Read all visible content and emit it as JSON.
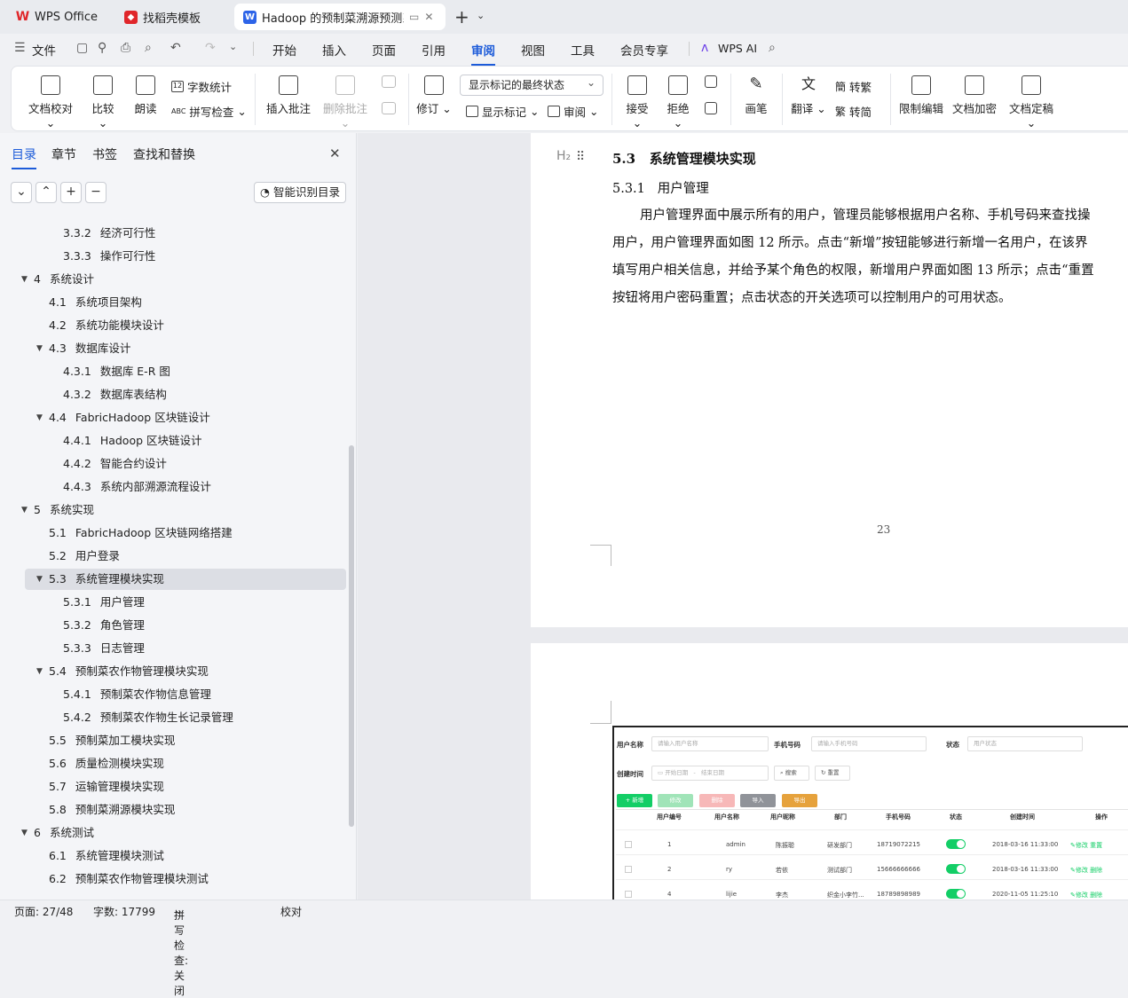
{
  "tabs": [
    {
      "label": "WPS Office"
    },
    {
      "label": "找稻壳模板"
    },
    {
      "label": "Hadoop 的预制菜溯源预测系"
    }
  ],
  "menu": {
    "file": "文件",
    "items": [
      "开始",
      "插入",
      "页面",
      "引用",
      "审阅",
      "视图",
      "工具",
      "会员专享"
    ],
    "active": "审阅",
    "ai": "WPS AI"
  },
  "ribbon": {
    "proof": "文档校对",
    "compare": "比较",
    "read": "朗读",
    "wordcount": "字数统计",
    "spell": "拼写检查",
    "insert_comment": "插入批注",
    "delete_comment": "删除批注",
    "revise": "修订",
    "markup_state": "显示标记的最终状态",
    "show_markup": "显示标记",
    "review": "审阅",
    "accept": "接受",
    "reject": "拒绝",
    "pen": "画笔",
    "translate": "翻译",
    "to_trad": "转繁",
    "to_simp": "转简",
    "restrict": "限制编辑",
    "encrypt": "文档加密",
    "finalize": "文档定稿"
  },
  "panel": {
    "tabs": [
      "目录",
      "章节",
      "书签",
      "查找和替换"
    ],
    "smart": "智能识别目录"
  },
  "toc": [
    {
      "num": "3.3.2",
      "text": "经济可行性",
      "level": 3
    },
    {
      "num": "3.3.3",
      "text": "操作可行性",
      "level": 3
    },
    {
      "num": "4",
      "text": "系统设计",
      "level": 1
    },
    {
      "num": "4.1",
      "text": "系统项目架构",
      "level": 2
    },
    {
      "num": "4.2",
      "text": "系统功能模块设计",
      "level": 2
    },
    {
      "num": "4.3",
      "text": "数据库设计",
      "level": 2
    },
    {
      "num": "4.3.1",
      "text": "数据库 E-R 图",
      "level": 3
    },
    {
      "num": "4.3.2",
      "text": "数据库表结构",
      "level": 3
    },
    {
      "num": "4.4",
      "text": "FabricHadoop 区块链设计",
      "level": 2
    },
    {
      "num": "4.4.1",
      "text": "Hadoop 区块链设计",
      "level": 3
    },
    {
      "num": "4.4.2",
      "text": "智能合约设计",
      "level": 3
    },
    {
      "num": "4.4.3",
      "text": "系统内部溯源流程设计",
      "level": 3
    },
    {
      "num": "5",
      "text": "系统实现",
      "level": 1
    },
    {
      "num": "5.1",
      "text": "FabricHadoop 区块链网络搭建",
      "level": 2
    },
    {
      "num": "5.2",
      "text": "用户登录",
      "level": 2
    },
    {
      "num": "5.3",
      "text": "系统管理模块实现",
      "level": 2
    },
    {
      "num": "5.3.1",
      "text": "用户管理",
      "level": 3
    },
    {
      "num": "5.3.2",
      "text": "角色管理",
      "level": 3
    },
    {
      "num": "5.3.3",
      "text": "日志管理",
      "level": 3
    },
    {
      "num": "5.4",
      "text": "预制菜农作物管理模块实现",
      "level": 2
    },
    {
      "num": "5.4.1",
      "text": "预制菜农作物信息管理",
      "level": 3
    },
    {
      "num": "5.4.2",
      "text": "预制菜农作物生长记录管理",
      "level": 3
    },
    {
      "num": "5.5",
      "text": "预制菜加工模块实现",
      "level": 2
    },
    {
      "num": "5.6",
      "text": "质量检测模块实现",
      "level": 2
    },
    {
      "num": "5.7",
      "text": "运输管理模块实现",
      "level": 2
    },
    {
      "num": "5.8",
      "text": "预制菜溯源模块实现",
      "level": 2
    },
    {
      "num": "6",
      "text": "系统测试",
      "level": 1
    },
    {
      "num": "6.1",
      "text": "系统管理模块测试",
      "level": 2
    },
    {
      "num": "6.2",
      "text": "预制菜农作物管理模块测试",
      "level": 2
    }
  ],
  "doc": {
    "heading_num": "5.3",
    "heading": "系统管理模块实现",
    "sub_num": "5.3.1",
    "sub": "用户管理",
    "lines": [
      "用户管理界面中展示所有的用户，管理员能够根据用户名称、手机号码来查找操",
      "用户，用户管理界面如图 12 所示。点击“新增”按钮能够进行新增一名用户，在该界",
      "填写用户相关信息，并给予某个角色的权限，新增用户界面如图 13 所示；点击“重置",
      "按钮将用户密码重置；点击状态的开关选项可以控制用户的可用状态。"
    ],
    "page_number": "23"
  },
  "shot": {
    "l_user": "用户名称",
    "ph_user": "请输入用户名称",
    "l_phone": "手机号码",
    "ph_phone": "请输入手机号码",
    "l_status": "状态",
    "ph_status": "用户状态",
    "l_time": "创建时间",
    "ph_start": "开始日期",
    "ph_end": "结束日期",
    "search": "搜索",
    "reset": "重置",
    "btns": [
      "+ 新增",
      "修改",
      "删除",
      "导入",
      "导出"
    ],
    "headers": [
      "用户编号",
      "用户名称",
      "用户昵称",
      "部门",
      "手机号码",
      "状态",
      "创建时间",
      "操作"
    ],
    "rows": [
      [
        "1",
        "admin",
        "陈振聪",
        "研发部门",
        "18719072215",
        "2018-03-16 11:33:00"
      ],
      [
        "2",
        "ry",
        "若依",
        "测试部门",
        "15666666666",
        "2018-03-16 11:33:00"
      ],
      [
        "4",
        "lijie",
        "李杰",
        "织金小李竹...",
        "18789898989",
        "2020-11-05 11:25:10"
      ]
    ],
    "op_edit": "修改",
    "op_del": "删除",
    "op_reset": "重置"
  },
  "status": {
    "page": "页面: 27/48",
    "words": "字数: 17799",
    "spell": "拼写检查: 关闭",
    "proof": "校对"
  }
}
